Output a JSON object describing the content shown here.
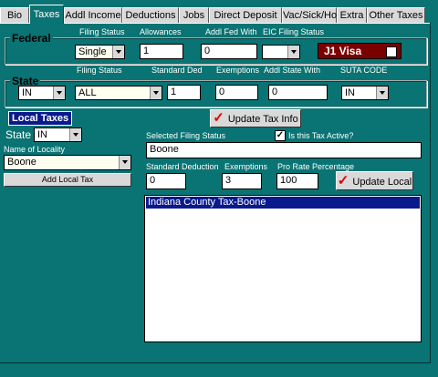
{
  "tabs": [
    "Bio",
    "Taxes",
    "Addl Income",
    "Deductions",
    "Jobs",
    "Direct Deposit",
    "Vac/Sick/Hol",
    "Extra",
    "Other Taxes"
  ],
  "federal": {
    "title": "Federal",
    "filing_status_label": "Filing Status",
    "filing_status": "Single",
    "allowances_label": "Allowances",
    "allowances": "1",
    "addl_fed_label": "Addl Fed With",
    "addl_fed": "0",
    "eic_label": "EIC Filing Status",
    "eic": "",
    "j1_label": "J1 Visa"
  },
  "state": {
    "title": "State",
    "state_value": "IN",
    "filing_status_label": "Filing Status",
    "filing_status": "ALL",
    "standard_ded_label": "Standard Ded",
    "standard_ded": "1",
    "exemptions_label": "Exemptions",
    "exemptions": "0",
    "addl_state_label": "Addl State With",
    "addl_state": "0",
    "suta_label": "SUTA CODE",
    "suta": "IN"
  },
  "update_tax_button": "Update Tax Info",
  "local": {
    "heading": "Local Taxes",
    "state_label": "State",
    "state_value": "IN",
    "locality_label": "Name of Locality",
    "locality": "Boone",
    "add_button": "Add Local Tax",
    "selected_filing_label": "Selected Filing Status",
    "selected_filing": "Boone",
    "active_label": "Is this Tax Active?",
    "active_checked": true,
    "std_ded_label": "Standard Deduction",
    "std_ded": "0",
    "exemptions_label": "Exemptions",
    "exemptions": "3",
    "pro_rate_label": "Pro Rate Percentage",
    "pro_rate": "100",
    "update_button": "Update Local",
    "list_items": [
      "Indiana County Tax-Boone"
    ]
  },
  "colors": {
    "background": "#0a7373",
    "accent_check": "#e00000",
    "j1_bg": "#7a0000",
    "list_selection": "#0a1a8c"
  }
}
